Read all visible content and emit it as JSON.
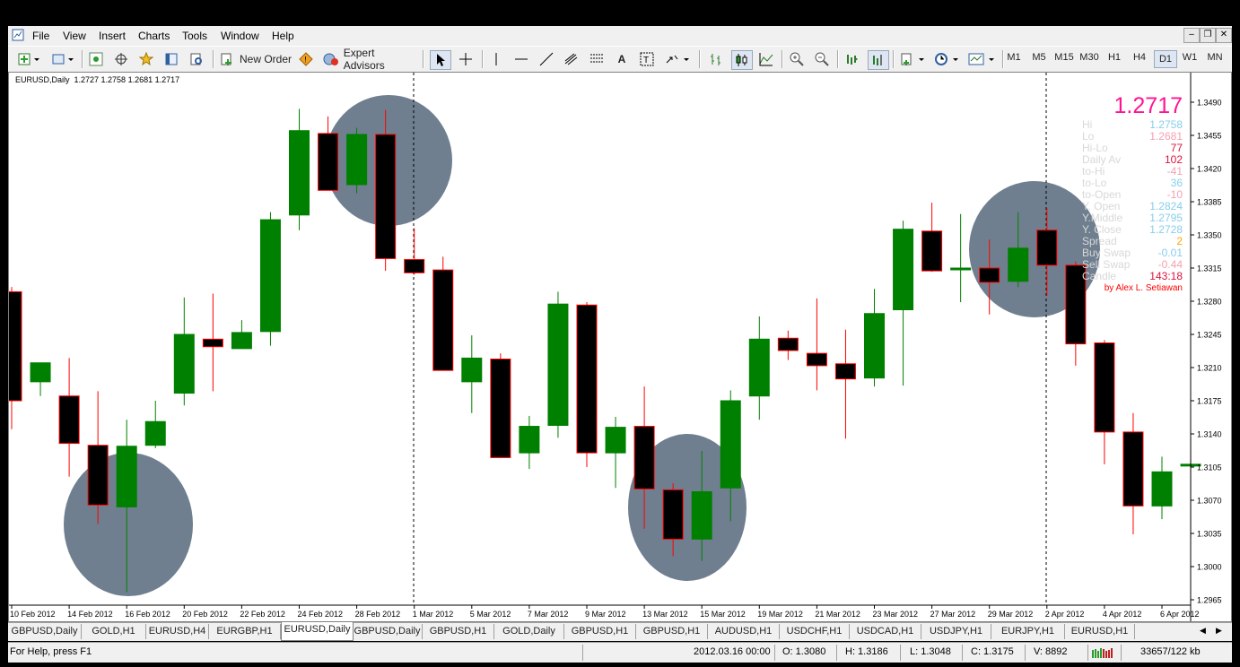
{
  "menu": [
    "File",
    "View",
    "Insert",
    "Charts",
    "Tools",
    "Window",
    "Help"
  ],
  "toolbar": {
    "new_order_label": "New Order",
    "expert_advisors_label": "Expert Advisors",
    "timeframes": [
      "M1",
      "M5",
      "M15",
      "M30",
      "H1",
      "H4",
      "D1",
      "W1",
      "MN"
    ],
    "active_timeframe": "D1"
  },
  "chart": {
    "header": "EURUSD,Daily  1.2727 1.2758 1.2681 1.2717",
    "price_labels": [
      "1.3490",
      "1.3455",
      "1.3420",
      "1.3385",
      "1.3350",
      "1.3315",
      "1.3280",
      "1.3245",
      "1.3210",
      "1.3175",
      "1.3140",
      "1.3105",
      "1.3070",
      "1.3035",
      "1.3000",
      "1.2965"
    ],
    "date_labels": [
      "10 Feb 2012",
      "14 Feb 2012",
      "16 Feb 2012",
      "20 Feb 2012",
      "22 Feb 2012",
      "24 Feb 2012",
      "28 Feb 2012",
      "1 Mar 2012",
      "5 Mar 2012",
      "7 Mar 2012",
      "9 Mar 2012",
      "13 Mar 2012",
      "15 Mar 2012",
      "19 Mar 2012",
      "21 Mar 2012",
      "23 Mar 2012",
      "27 Mar 2012",
      "29 Mar 2012",
      "2 Apr 2012",
      "4 Apr 2012",
      "6 Apr 2012"
    ],
    "colors": {
      "bull": "#008000",
      "bear": "#000000",
      "bear_outline": "#ff0000",
      "wick_bull": "#008000",
      "wick_bear": "#ff0000",
      "highlight": "#6f7f8f"
    }
  },
  "info_panel": {
    "price": "1.2717",
    "rows": [
      {
        "label": "Hi",
        "value": "1.2758",
        "label_color": "#d8d8d8",
        "value_color": "#87ceeb"
      },
      {
        "label": "Lo",
        "value": "1.2681",
        "label_color": "#d8d8d8",
        "value_color": "#f4a0b0"
      },
      {
        "label": "Hi-Lo",
        "value": "77",
        "label_color": "#d8d8d8",
        "value_color": "#dc143c"
      },
      {
        "label": "Daily Av",
        "value": "102",
        "label_color": "#d8d8d8",
        "value_color": "#dc143c"
      },
      {
        "label": "to-Hi",
        "value": "-41",
        "label_color": "#d8d8d8",
        "value_color": "#f4a0b0"
      },
      {
        "label": "to-Lo",
        "value": "36",
        "label_color": "#d8d8d8",
        "value_color": "#87ceeb"
      },
      {
        "label": "to-Open",
        "value": "-10",
        "label_color": "#d8d8d8",
        "value_color": "#f4a0b0"
      },
      {
        "label": "Y. Open",
        "value": "1.2824",
        "label_color": "#d8d8d8",
        "value_color": "#87ceeb"
      },
      {
        "label": "Y.Middle",
        "value": "1.2795",
        "label_color": "#d8d8d8",
        "value_color": "#87ceeb"
      },
      {
        "label": "Y. Close",
        "value": "1.2728",
        "label_color": "#d8d8d8",
        "value_color": "#87ceeb"
      },
      {
        "label": "Spread",
        "value": "2",
        "label_color": "#d8d8d8",
        "value_color": "#ffa500"
      },
      {
        "label": "Buy Swap",
        "value": "-0.01",
        "label_color": "#d8d8d8",
        "value_color": "#87ceeb"
      },
      {
        "label": "Sell Swap",
        "value": "-0.44",
        "label_color": "#d8d8d8",
        "value_color": "#f4a0b0"
      },
      {
        "label": "Candle",
        "value": "143:18",
        "label_color": "#d8d8d8",
        "value_color": "#dc143c"
      }
    ],
    "credit": "by Alex L. Setiawan"
  },
  "tabs": [
    "GBPUSD,Daily",
    "GOLD,H1",
    "EURUSD,H4",
    "EURGBP,H1",
    "EURUSD,Daily",
    "GBPUSD,Daily",
    "GBPUSD,H1",
    "GOLD,Daily",
    "GBPUSD,H1",
    "GBPUSD,H1",
    "AUDUSD,H1",
    "USDCHF,H1",
    "USDCAD,H1",
    "USDJPY,H1",
    "EURJPY,H1",
    "EURUSD,H1"
  ],
  "active_tab": "EURUSD,Daily",
  "status": {
    "help": "For Help, press F1",
    "datetime": "2012.03.16 00:00",
    "open": "O: 1.3080",
    "high": "H: 1.3186",
    "low": "L: 1.3048",
    "close": "C: 1.3175",
    "volume": "V: 8892",
    "traffic": "33657/122 kb"
  },
  "chart_data": {
    "type": "candlestick",
    "symbol": "EURUSD",
    "timeframe": "Daily",
    "ylim": [
      1.295,
      1.351
    ],
    "candles": [
      {
        "o": 1.329,
        "h": 1.3295,
        "l": 1.3145,
        "c": 1.3175
      },
      {
        "o": 1.3195,
        "h": 1.3215,
        "l": 1.318,
        "c": 1.3215
      },
      {
        "o": 1.318,
        "h": 1.322,
        "l": 1.3095,
        "c": 1.313
      },
      {
        "o": 1.3128,
        "h": 1.3185,
        "l": 1.3045,
        "c": 1.3065
      },
      {
        "o": 1.3063,
        "h": 1.3155,
        "l": 1.2973,
        "c": 1.3127
      },
      {
        "o": 1.3128,
        "h": 1.3175,
        "l": 1.3125,
        "c": 1.3153
      },
      {
        "o": 1.3183,
        "h": 1.3284,
        "l": 1.317,
        "c": 1.3245
      },
      {
        "o": 1.324,
        "h": 1.3288,
        "l": 1.3185,
        "c": 1.3232
      },
      {
        "o": 1.323,
        "h": 1.326,
        "l": 1.323,
        "c": 1.3247
      },
      {
        "o": 1.3248,
        "h": 1.3374,
        "l": 1.3233,
        "c": 1.3366
      },
      {
        "o": 1.3371,
        "h": 1.3483,
        "l": 1.3355,
        "c": 1.346
      },
      {
        "o": 1.3457,
        "h": 1.3475,
        "l": 1.3397,
        "c": 1.3397
      },
      {
        "o": 1.3403,
        "h": 1.3463,
        "l": 1.3394,
        "c": 1.3456
      },
      {
        "o": 1.3456,
        "h": 1.3482,
        "l": 1.3312,
        "c": 1.3325
      },
      {
        "o": 1.3324,
        "h": 1.3357,
        "l": 1.3308,
        "c": 1.331
      },
      {
        "o": 1.3313,
        "h": 1.3327,
        "l": 1.3207,
        "c": 1.3207
      },
      {
        "o": 1.3195,
        "h": 1.3244,
        "l": 1.3162,
        "c": 1.322
      },
      {
        "o": 1.3219,
        "h": 1.3225,
        "l": 1.3115,
        "c": 1.3115
      },
      {
        "o": 1.312,
        "h": 1.3159,
        "l": 1.3103,
        "c": 1.3148
      },
      {
        "o": 1.3149,
        "h": 1.329,
        "l": 1.3136,
        "c": 1.3277
      },
      {
        "o": 1.3276,
        "h": 1.3279,
        "l": 1.3105,
        "c": 1.312
      },
      {
        "o": 1.312,
        "h": 1.3158,
        "l": 1.3083,
        "c": 1.3147
      },
      {
        "o": 1.3148,
        "h": 1.319,
        "l": 1.304,
        "c": 1.3082
      },
      {
        "o": 1.3081,
        "h": 1.3088,
        "l": 1.3011,
        "c": 1.3029
      },
      {
        "o": 1.3029,
        "h": 1.3122,
        "l": 1.3006,
        "c": 1.3079
      },
      {
        "o": 1.3083,
        "h": 1.3186,
        "l": 1.3048,
        "c": 1.3175
      },
      {
        "o": 1.318,
        "h": 1.3264,
        "l": 1.3155,
        "c": 1.324
      },
      {
        "o": 1.3241,
        "h": 1.3249,
        "l": 1.3218,
        "c": 1.3228
      },
      {
        "o": 1.3225,
        "h": 1.3283,
        "l": 1.3186,
        "c": 1.3212
      },
      {
        "o": 1.3214,
        "h": 1.325,
        "l": 1.3135,
        "c": 1.3198
      },
      {
        "o": 1.3199,
        "h": 1.3293,
        "l": 1.319,
        "c": 1.3267
      },
      {
        "o": 1.3271,
        "h": 1.3365,
        "l": 1.3191,
        "c": 1.3356
      },
      {
        "o": 1.3354,
        "h": 1.3384,
        "l": 1.3311,
        "c": 1.3312
      },
      {
        "o": 1.3315,
        "h": 1.3372,
        "l": 1.3279,
        "c": 1.3315
      },
      {
        "o": 1.3315,
        "h": 1.3345,
        "l": 1.3266,
        "c": 1.33
      },
      {
        "o": 1.3301,
        "h": 1.3374,
        "l": 1.3295,
        "c": 1.3336
      },
      {
        "o": 1.3355,
        "h": 1.3378,
        "l": 1.3286,
        "c": 1.3318
      },
      {
        "o": 1.3318,
        "h": 1.3322,
        "l": 1.3212,
        "c": 1.3235
      },
      {
        "o": 1.3236,
        "h": 1.3239,
        "l": 1.3108,
        "c": 1.3142
      },
      {
        "o": 1.3142,
        "h": 1.3162,
        "l": 1.3034,
        "c": 1.3064
      },
      {
        "o": 1.3064,
        "h": 1.3116,
        "l": 1.305,
        "c": 1.31
      },
      {
        "o": 1.3108,
        "h": 1.3137,
        "l": 1.303,
        "c": 1.3108
      }
    ],
    "markers": [
      "1 Mar 2012",
      "2 Apr 2012"
    ]
  }
}
